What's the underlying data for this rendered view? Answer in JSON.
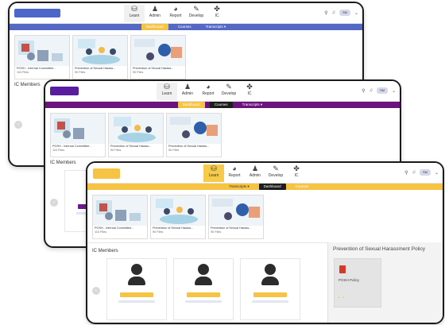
{
  "colors": {
    "blue_accent": "#5569c4",
    "blue_logo": "#4a67c9",
    "purple_accent": "#6a137c",
    "purple_logo": "#5b1da0",
    "yellow_accent": "#f6c342",
    "yellow_logo": "#f6c342",
    "dark_tab": "#1c1c1c",
    "member_bar_purple": "#6c1a8c",
    "member_bar_yellow": "#f6c342"
  },
  "nav_items": [
    {
      "label": "Learn",
      "icon": "learn-icon",
      "glyph": "⛁"
    },
    {
      "label": "Admin",
      "icon": "admin-icon",
      "glyph": "♟"
    },
    {
      "label": "Report",
      "icon": "report-icon",
      "glyph": "◕"
    },
    {
      "label": "Develop",
      "icon": "develop-icon",
      "glyph": "✎"
    },
    {
      "label": "IC",
      "icon": "ic-icon",
      "glyph": "✤"
    }
  ],
  "nav_items_s3": [
    {
      "label": "Learn",
      "icon": "learn-icon",
      "glyph": "⛁"
    },
    {
      "label": "Report",
      "icon": "report-icon",
      "glyph": "◕"
    },
    {
      "label": "Admin",
      "icon": "admin-icon",
      "glyph": "♟"
    },
    {
      "label": "Develop",
      "icon": "develop-icon",
      "glyph": "✎"
    },
    {
      "label": "IC",
      "icon": "ic-icon",
      "glyph": "✤"
    }
  ],
  "top_right": {
    "search_glyph": "⚲",
    "bell_glyph": "♫",
    "avatar_text": "SM",
    "caret": "⌄"
  },
  "subnav": {
    "s1": [
      "Dashboard",
      "Courses",
      "Transcripts ▾"
    ],
    "s2": [
      "Dashboard",
      "Courses",
      "Transcripts ▾"
    ],
    "s3": [
      "Transcripts ▾",
      "Dashboard",
      "Courses"
    ]
  },
  "cards": [
    {
      "title": "POSH - Internal Committee...",
      "files": "110 Files"
    },
    {
      "title": "Prevention of Sexual Harass...",
      "files": "90 Files"
    },
    {
      "title": "Prevention of Sexual Harass...",
      "files": "90 Files"
    }
  ],
  "section": {
    "members_title": "IC Members",
    "members_title_short": "IC Members"
  },
  "arrow_glyph": "‹",
  "policy": {
    "title": "Prevention of Sexual Harassment Policy",
    "doc_name": "POSH Policy",
    "dots": "• •"
  }
}
